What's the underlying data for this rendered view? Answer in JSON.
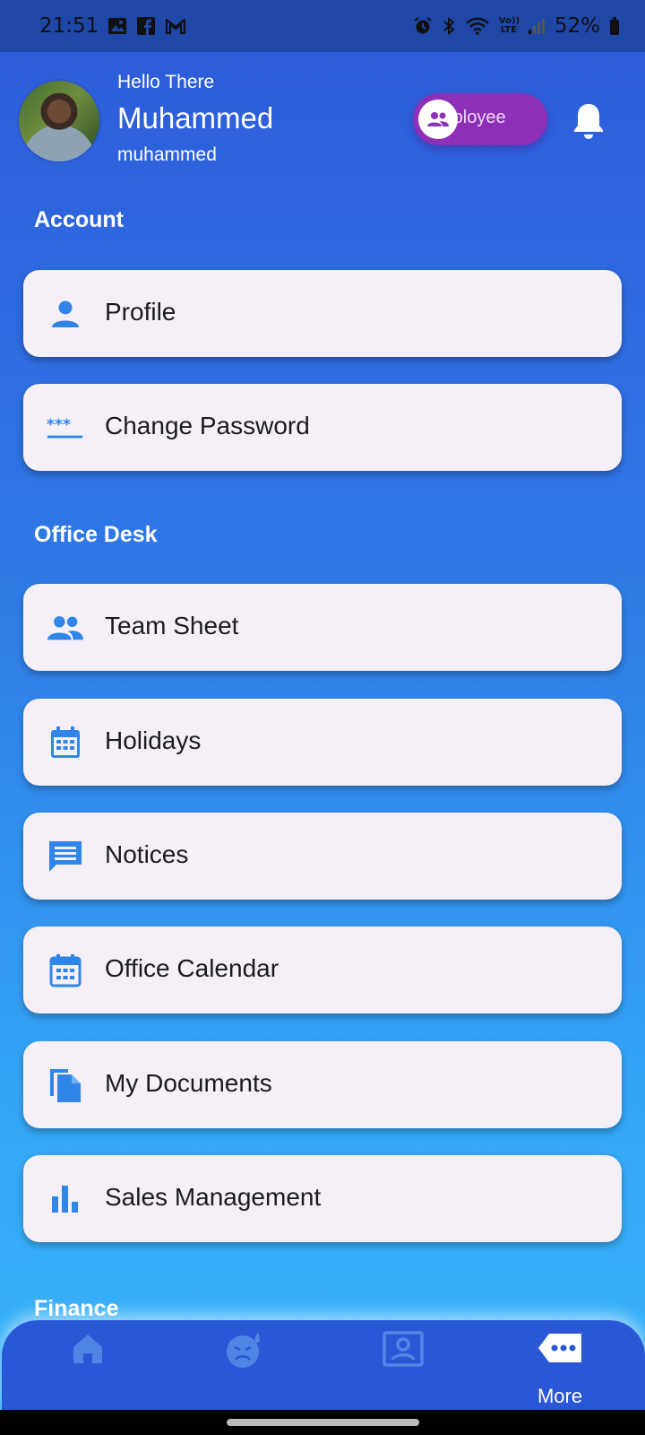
{
  "status_bar": {
    "time": "21:51",
    "battery": "52%",
    "left_icons": [
      "gallery-icon",
      "facebook-icon",
      "gmail-icon"
    ],
    "right_icons": [
      "alarm-icon",
      "bluetooth-icon",
      "wifi-icon",
      "volte-icon",
      "signal-icon",
      "battery-icon"
    ],
    "volte_label": "Vo)) LTE"
  },
  "header": {
    "greeting": "Hello There",
    "name": "Muhammed",
    "username": "muhammed",
    "role": "mployee",
    "role_icon": "group-icon",
    "notifications_icon": "bell-icon"
  },
  "sections": {
    "account": {
      "title": "Account",
      "items": [
        {
          "label": "Profile",
          "icon": "person-icon"
        },
        {
          "label": "Change Password",
          "icon": "password-icon"
        }
      ]
    },
    "office_desk": {
      "title": "Office Desk",
      "items": [
        {
          "label": "Team Sheet",
          "icon": "people-icon"
        },
        {
          "label": "Holidays",
          "icon": "calendar-grid-icon"
        },
        {
          "label": "Notices",
          "icon": "message-icon"
        },
        {
          "label": "Office Calendar",
          "icon": "calendar-icon"
        },
        {
          "label": "My Documents",
          "icon": "documents-icon"
        },
        {
          "label": "Sales Management",
          "icon": "bar-chart-icon"
        }
      ]
    },
    "finance": {
      "title": "Finance"
    }
  },
  "bottom_nav": {
    "items": [
      {
        "icon": "home-icon",
        "label": ""
      },
      {
        "icon": "mood-icon",
        "label": ""
      },
      {
        "icon": "contact-card-icon",
        "label": ""
      },
      {
        "icon": "more-icon",
        "label": "More"
      }
    ]
  },
  "colors": {
    "accent_icon": "#2f86e8",
    "card_bg": "#f5f0f7",
    "role_pill": "#8e2fb8",
    "nav_bg": "#2a57d6"
  }
}
